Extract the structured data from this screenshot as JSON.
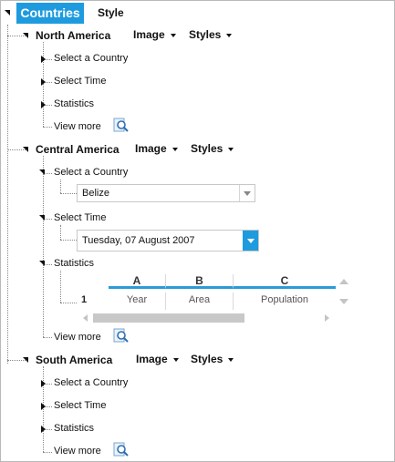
{
  "tabs": [
    {
      "label": "Countries",
      "active": true
    },
    {
      "label": "Style",
      "active": false
    }
  ],
  "regions": [
    {
      "name": "North America",
      "menus": [
        "Image",
        "Styles"
      ],
      "items": [
        "Select a Country",
        "Select Time",
        "Statistics"
      ],
      "view_more": "View more"
    },
    {
      "name": "Central America",
      "menus": [
        "Image",
        "Styles"
      ],
      "items": [
        "Select a Country",
        "Select Time",
        "Statistics"
      ],
      "view_more": "View more",
      "country_value": "Belize",
      "date_value": "Tuesday, 07 August 2007",
      "grid": {
        "columns": [
          "A",
          "B",
          "C"
        ],
        "row_number": "1",
        "row": [
          "Year",
          "Area",
          "Population"
        ]
      }
    },
    {
      "name": "South America",
      "menus": [
        "Image",
        "Styles"
      ],
      "items": [
        "Select a Country",
        "Select Time",
        "Statistics"
      ],
      "view_more": "View more"
    }
  ],
  "colors": {
    "accent": "#1e9bde",
    "grid_header_rule": "#2b9bd8"
  },
  "icons": {
    "expanded": "triangle-down-icon",
    "collapsed": "triangle-right-icon",
    "view_more": "magnifier-icon"
  }
}
